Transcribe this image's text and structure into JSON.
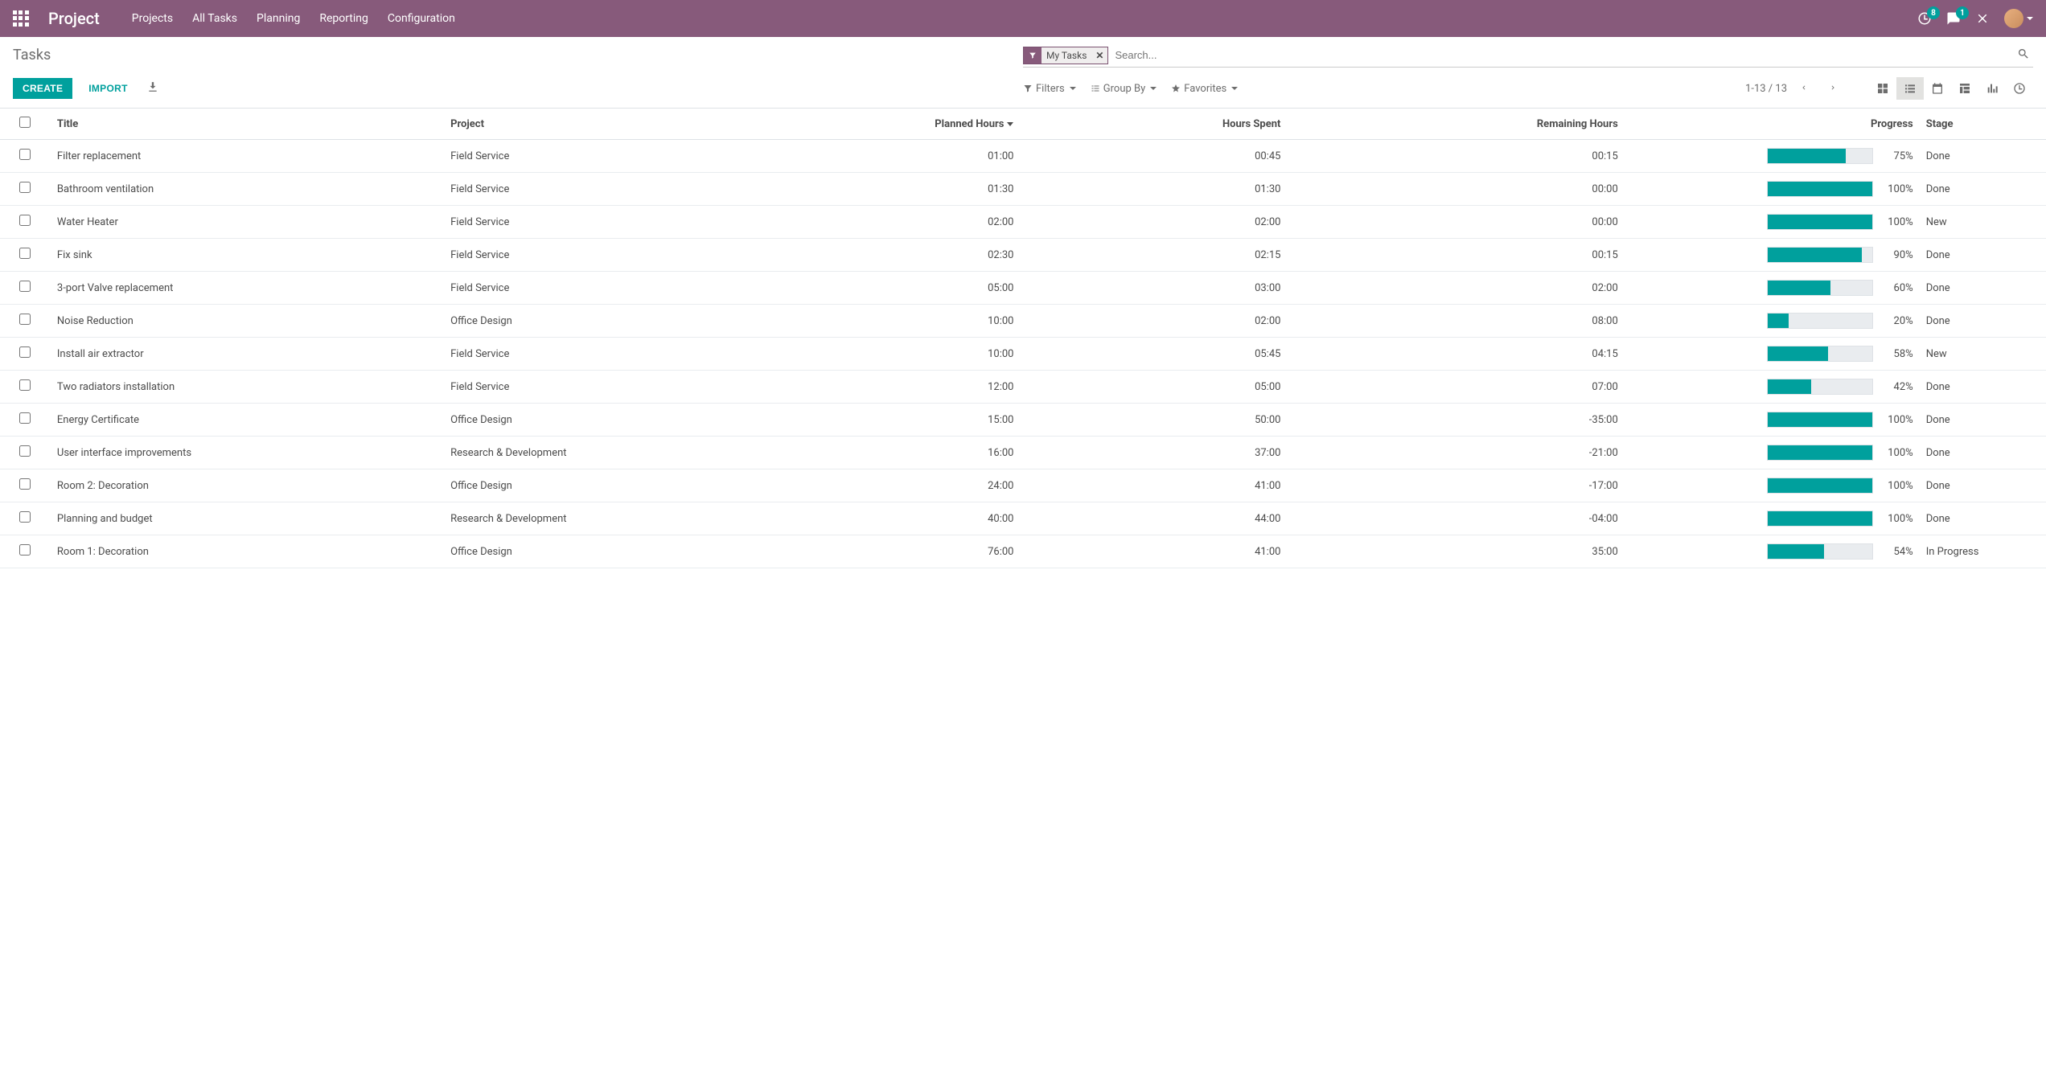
{
  "nav": {
    "brand": "Project",
    "menu": [
      "Projects",
      "All Tasks",
      "Planning",
      "Reporting",
      "Configuration"
    ],
    "activities_badge": "8",
    "messages_badge": "1"
  },
  "breadcrumb": "Tasks",
  "search": {
    "facet_label": "My Tasks",
    "placeholder": "Search..."
  },
  "buttons": {
    "create": "CREATE",
    "import": "IMPORT"
  },
  "filters": {
    "filters": "Filters",
    "group_by": "Group By",
    "favorites": "Favorites"
  },
  "pager": {
    "range": "1-13 / 13"
  },
  "columns": {
    "title": "Title",
    "project": "Project",
    "planned": "Planned Hours",
    "spent": "Hours Spent",
    "remaining": "Remaining Hours",
    "progress": "Progress",
    "stage": "Stage"
  },
  "rows": [
    {
      "title": "Filter replacement",
      "project": "Field Service",
      "planned": "01:00",
      "spent": "00:45",
      "remaining": "00:15",
      "pct": "75%",
      "bar": 75,
      "stage": "Done"
    },
    {
      "title": "Bathroom ventilation",
      "project": "Field Service",
      "planned": "01:30",
      "spent": "01:30",
      "remaining": "00:00",
      "pct": "100%",
      "bar": 100,
      "stage": "Done"
    },
    {
      "title": "Water Heater",
      "project": "Field Service",
      "planned": "02:00",
      "spent": "02:00",
      "remaining": "00:00",
      "pct": "100%",
      "bar": 100,
      "stage": "New"
    },
    {
      "title": "Fix sink",
      "project": "Field Service",
      "planned": "02:30",
      "spent": "02:15",
      "remaining": "00:15",
      "pct": "90%",
      "bar": 90,
      "stage": "Done"
    },
    {
      "title": "3-port Valve replacement",
      "project": "Field Service",
      "planned": "05:00",
      "spent": "03:00",
      "remaining": "02:00",
      "pct": "60%",
      "bar": 60,
      "stage": "Done"
    },
    {
      "title": "Noise Reduction",
      "project": "Office Design",
      "planned": "10:00",
      "spent": "02:00",
      "remaining": "08:00",
      "pct": "20%",
      "bar": 20,
      "stage": "Done"
    },
    {
      "title": "Install air extractor",
      "project": "Field Service",
      "planned": "10:00",
      "spent": "05:45",
      "remaining": "04:15",
      "pct": "58%",
      "bar": 58,
      "stage": "New"
    },
    {
      "title": "Two radiators installation",
      "project": "Field Service",
      "planned": "12:00",
      "spent": "05:00",
      "remaining": "07:00",
      "pct": "42%",
      "bar": 42,
      "stage": "Done"
    },
    {
      "title": "Energy Certificate",
      "project": "Office Design",
      "planned": "15:00",
      "spent": "50:00",
      "remaining": "-35:00",
      "pct": "100%",
      "bar": 100,
      "stage": "Done"
    },
    {
      "title": "User interface improvements",
      "project": "Research & Development",
      "planned": "16:00",
      "spent": "37:00",
      "remaining": "-21:00",
      "pct": "100%",
      "bar": 100,
      "stage": "Done"
    },
    {
      "title": "Room 2: Decoration",
      "project": "Office Design",
      "planned": "24:00",
      "spent": "41:00",
      "remaining": "-17:00",
      "pct": "100%",
      "bar": 100,
      "stage": "Done"
    },
    {
      "title": "Planning and budget",
      "project": "Research & Development",
      "planned": "40:00",
      "spent": "44:00",
      "remaining": "-04:00",
      "pct": "100%",
      "bar": 100,
      "stage": "Done"
    },
    {
      "title": "Room 1: Decoration",
      "project": "Office Design",
      "planned": "76:00",
      "spent": "41:00",
      "remaining": "35:00",
      "pct": "54%",
      "bar": 54,
      "stage": "In Progress"
    }
  ]
}
